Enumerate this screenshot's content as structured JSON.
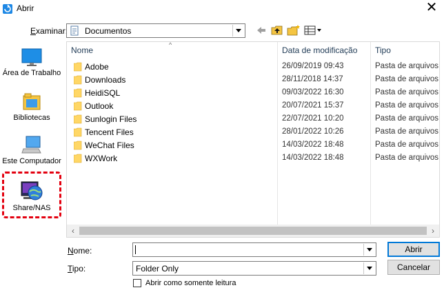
{
  "window": {
    "title": "Abrir",
    "close_glyph": "✕"
  },
  "lookin": {
    "label": "Examinar:",
    "value": "Documentos"
  },
  "places": [
    {
      "label": "Área de Trabalho"
    },
    {
      "label": "Bibliotecas"
    },
    {
      "label": "Este Computador"
    },
    {
      "label": "Share/NAS"
    }
  ],
  "columns": {
    "name": "Nome",
    "date": "Data de modificação",
    "type": "Tipo"
  },
  "files": [
    {
      "name": "Adobe",
      "date": "26/09/2019 09:43",
      "type": "Pasta de arquivos"
    },
    {
      "name": "Downloads",
      "date": "28/11/2018 14:37",
      "type": "Pasta de arquivos"
    },
    {
      "name": "HeidiSQL",
      "date": "09/03/2022 16:30",
      "type": "Pasta de arquivos"
    },
    {
      "name": "Outlook",
      "date": "20/07/2021 15:37",
      "type": "Pasta de arquivos"
    },
    {
      "name": "Sunlogin Files",
      "date": "22/07/2021 10:20",
      "type": "Pasta de arquivos"
    },
    {
      "name": "Tencent Files",
      "date": "28/01/2022 10:26",
      "type": "Pasta de arquivos"
    },
    {
      "name": "WeChat Files",
      "date": "14/03/2022 18:48",
      "type": "Pasta de arquivos"
    },
    {
      "name": "WXWork",
      "date": "14/03/2022 18:48",
      "type": "Pasta de arquivos"
    }
  ],
  "filename": {
    "label_underline": "N",
    "label_rest": "ome:",
    "value": ""
  },
  "filetype": {
    "label_underline": "T",
    "label_rest": "ipo:",
    "value": "Folder Only"
  },
  "buttons": {
    "open": "Abrir",
    "cancel": "Cancelar"
  },
  "readonly": {
    "label": "Abrir como somente leitura",
    "checked": false
  },
  "colors": {
    "highlight": "#e3000f",
    "folder": "#ffd766",
    "accent": "#0078d7"
  }
}
